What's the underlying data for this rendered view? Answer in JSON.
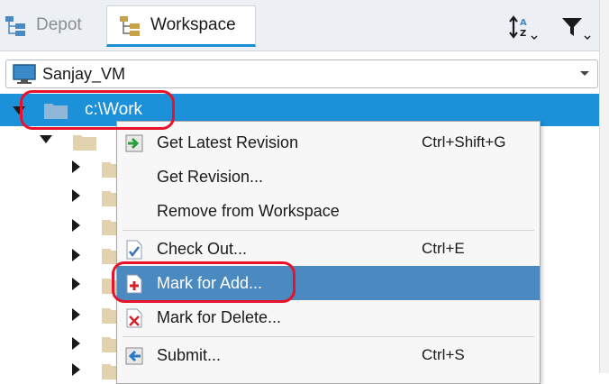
{
  "tabs": {
    "depot_label": "Depot",
    "workspace_label": "Workspace"
  },
  "workspace_selector": {
    "value": "Sanjay_VM"
  },
  "tree": {
    "root_label": "c:\\Work"
  },
  "context_menu": {
    "items": [
      {
        "label": "Get Latest Revision",
        "shortcut": "Ctrl+Shift+G",
        "icon": "get-latest-icon"
      },
      {
        "label": "Get Revision...",
        "shortcut": "",
        "icon": ""
      },
      {
        "label": "Remove from Workspace",
        "shortcut": "",
        "icon": ""
      },
      {
        "label": "Check Out...",
        "shortcut": "Ctrl+E",
        "icon": "checkout-icon"
      },
      {
        "label": "Mark for Add...",
        "shortcut": "",
        "icon": "mark-add-icon"
      },
      {
        "label": "Mark for Delete...",
        "shortcut": "",
        "icon": "mark-delete-icon"
      },
      {
        "label": "Submit...",
        "shortcut": "Ctrl+S",
        "icon": "submit-icon"
      }
    ],
    "highlighted_label": "Mark for Add..."
  },
  "colors": {
    "selection": "#1c90d8",
    "menu_highlight": "#4a8ac0",
    "annotation_circle": "#e8132a",
    "folder": "#d8c7a0"
  }
}
